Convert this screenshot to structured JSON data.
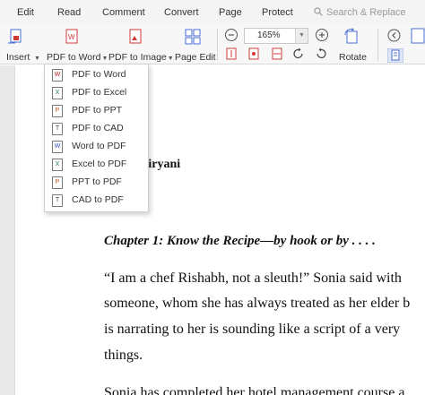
{
  "menubar": {
    "items": [
      "Edit",
      "Read",
      "Comment",
      "Convert",
      "Page",
      "Protect"
    ],
    "search_placeholder": "Search & Replace"
  },
  "ribbon": {
    "insert_label": "Insert",
    "pdf_to_word_label": "PDF to Word",
    "pdf_to_image_label": "PDF to Image",
    "page_edit_label": "Page Edit",
    "zoom_value": "165%",
    "rotate_label": "Rotate"
  },
  "dropdown": {
    "items": [
      "PDF to Word",
      "PDF to Excel",
      "PDF to PPT",
      "PDF to CAD",
      "Word to PDF",
      "Excel to PDF",
      "PPT to PDF",
      "CAD to PDF"
    ]
  },
  "document": {
    "title_fragment": "Biryani",
    "chapter_heading": "Chapter 1: Know the Recipe—by hook or by . . . .",
    "paragraph_lines": [
      "“I am a chef Rishabh, not a sleuth!” Sonia said with",
      "someone, whom she has always treated as her elder b",
      "is narrating to her is sounding like a script of a very",
      "things.",
      "Sonia has completed her hotel management course a"
    ]
  },
  "colors": {
    "accent": "#4a6fd6",
    "pdf_red": "#d23a3a",
    "menubar_bg": "#f4f4f4"
  }
}
